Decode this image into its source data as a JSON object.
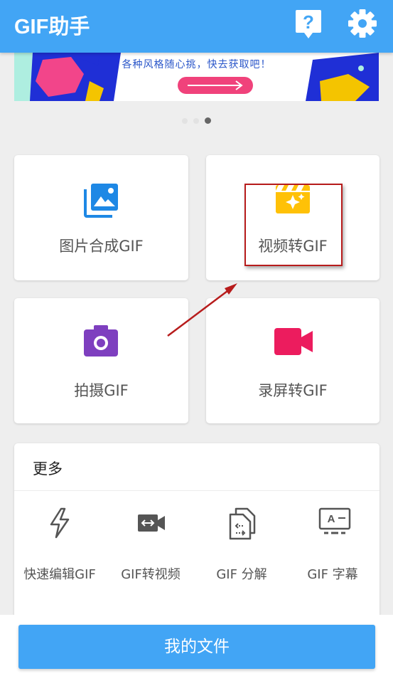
{
  "app": {
    "title": "GIF助手"
  },
  "banner": {
    "text": "各种风格随心挑，快去获取吧！"
  },
  "carousel": {
    "count": 3,
    "active_index": 2
  },
  "cards": [
    {
      "label": "图片合成GIF",
      "icon": "image-icon",
      "color": "#1e88e5"
    },
    {
      "label": "视频转GIF",
      "icon": "video-sparkle-icon",
      "color": "#ffc107"
    },
    {
      "label": "拍摄GIF",
      "icon": "camera-icon",
      "color": "#7e3fbf"
    },
    {
      "label": "录屏转GIF",
      "icon": "screen-record-icon",
      "color": "#ec1c5e"
    }
  ],
  "more": {
    "title": "更多",
    "tools": [
      {
        "label": "快速编辑GIF",
        "icon": "lightning-icon"
      },
      {
        "label": "GIF转视频",
        "icon": "gif-to-video-icon"
      },
      {
        "label": "GIF 分解",
        "icon": "split-files-icon"
      },
      {
        "label": "GIF 字幕",
        "icon": "subtitle-icon"
      }
    ]
  },
  "footer": {
    "files_button": "我的文件"
  },
  "colors": {
    "primary": "#42a5f5",
    "highlight": "#b71c1c"
  }
}
